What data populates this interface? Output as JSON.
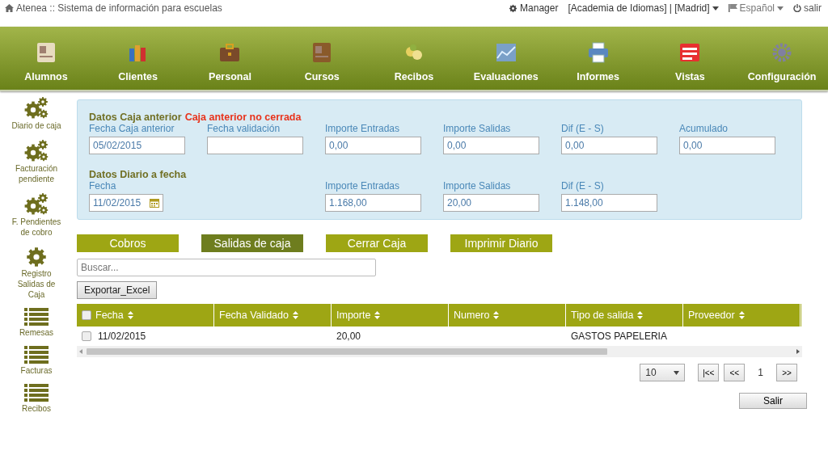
{
  "header": {
    "title": "Atenea :: Sistema de información para escuelas",
    "user": "Manager",
    "academy": "[Academia de Idiomas] | [Madrid]",
    "language": "Español",
    "logout": "salir"
  },
  "nav": [
    {
      "label": "Alumnos"
    },
    {
      "label": "Clientes"
    },
    {
      "label": "Personal"
    },
    {
      "label": "Cursos"
    },
    {
      "label": "Recibos"
    },
    {
      "label": "Evaluaciones"
    },
    {
      "label": "Informes"
    },
    {
      "label": "Vistas"
    },
    {
      "label": "Configuración"
    }
  ],
  "sidebar": [
    {
      "label": "Diario de caja",
      "kind": "gears"
    },
    {
      "label": "Facturación pendiente",
      "kind": "gears"
    },
    {
      "label": "F. Pendientes de cobro",
      "kind": "gears"
    },
    {
      "label": "Registro Salidas de Caja",
      "kind": "gear"
    },
    {
      "label": "Remesas",
      "kind": "list"
    },
    {
      "label": "Facturas",
      "kind": "list"
    },
    {
      "label": "Recibos",
      "kind": "list"
    }
  ],
  "previous": {
    "title": "Datos Caja anterior",
    "warning": "Caja anterior no cerrada",
    "fields": [
      {
        "label": "Fecha Caja anterior",
        "value": "05/02/2015",
        "kind": "text"
      },
      {
        "label": "Fecha validación",
        "kind": "text"
      },
      {
        "label": "Importe Entradas",
        "value": "0,00",
        "kind": "text"
      },
      {
        "label": "Importe Salidas",
        "value": "0,00",
        "kind": "text"
      },
      {
        "label": "Dif (E - S)",
        "value": "0,00",
        "kind": "text"
      },
      {
        "label": "Acumulado",
        "value": "0,00",
        "kind": "text"
      }
    ]
  },
  "current": {
    "title": "Datos Diario a fecha",
    "fields": [
      {
        "label": "Fecha",
        "value": "11/02/2015",
        "kind": "date"
      },
      {
        "label": "Importe Entradas",
        "value": "1.168,00",
        "kind": "text"
      },
      {
        "label": "Importe Salidas",
        "value": "20,00",
        "kind": "text"
      },
      {
        "label": "Dif (E - S)",
        "value": "1.148,00",
        "kind": "text"
      }
    ]
  },
  "actions": [
    {
      "label": "Cobros",
      "selected": false
    },
    {
      "label": "Salidas de caja",
      "selected": true
    },
    {
      "label": "Cerrar Caja",
      "selected": false
    },
    {
      "label": "Imprimir Diario",
      "selected": false
    }
  ],
  "search": {
    "placeholder": "Buscar..."
  },
  "export_button": "Exportar_Excel",
  "table": {
    "select_all": false,
    "columns": [
      "Fecha",
      "Fecha Validado",
      "Importe",
      "Numero",
      "Tipo de salida",
      "Proveedor"
    ],
    "rows": [
      {
        "checked": false,
        "cells": [
          "11/02/2015",
          "",
          "20,00",
          "",
          "GASTOS PAPELERIA",
          ""
        ]
      }
    ]
  },
  "pagination": {
    "page_size": "10",
    "first": "|<<",
    "prev": "<<",
    "page": "1",
    "next": ">>"
  },
  "exit_button": "Salir"
}
